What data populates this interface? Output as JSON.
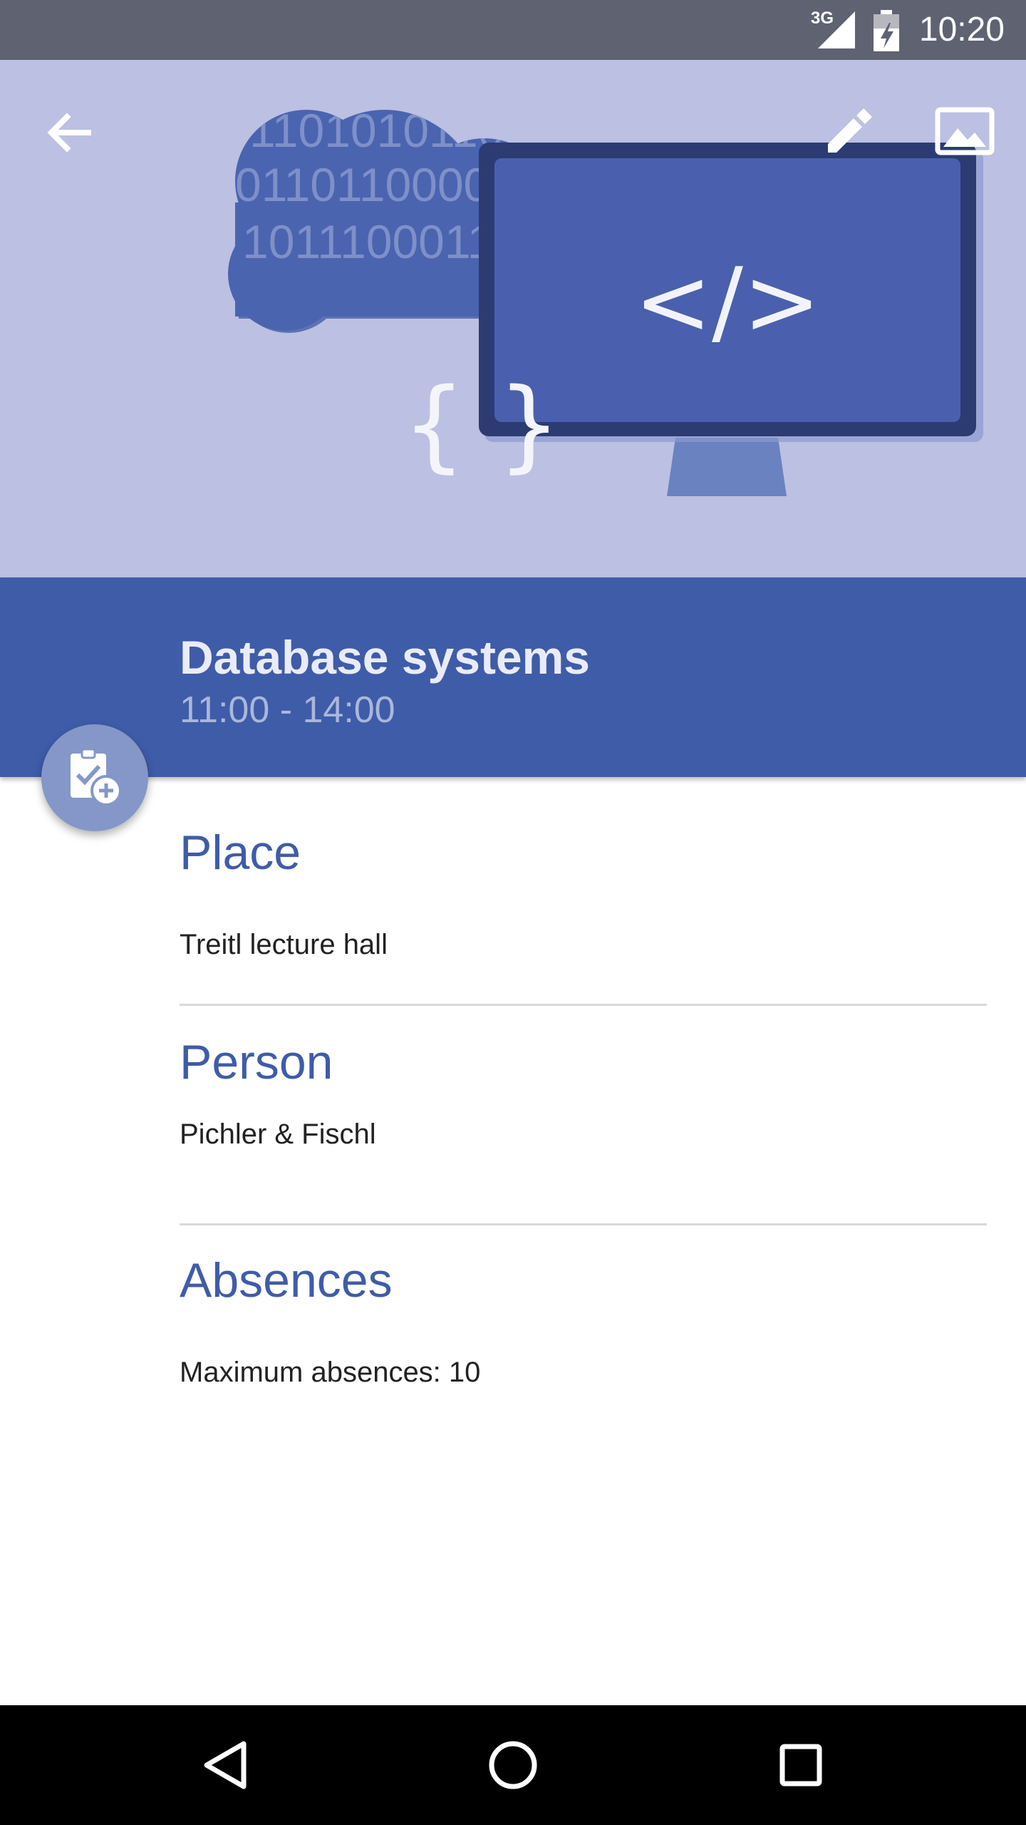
{
  "status_bar": {
    "time": "10:20",
    "network": "3G",
    "icons": [
      "signal-icon",
      "battery-icon"
    ]
  },
  "header": {
    "binary_lines": [
      "011000",
      "1101010110",
      "0110110000",
      "1011100011"
    ],
    "code_glyph": "</>",
    "braces_glyph": "{ }",
    "actions": {
      "back_icon": "arrow-back-icon",
      "edit_icon": "pencil-icon",
      "image_icon": "image-icon"
    }
  },
  "course": {
    "title": "Database systems",
    "time": "11:00 - 14:00"
  },
  "fab": {
    "icon": "clipboard-check-add-icon"
  },
  "sections": {
    "place": {
      "heading": "Place",
      "value": "Treitl lecture hall"
    },
    "person": {
      "heading": "Person",
      "value": "Pichler & Fischl"
    },
    "absences": {
      "heading": "Absences",
      "value": "Maximum absences: 10"
    }
  },
  "nav_bar": {
    "icons": [
      "back-triangle-icon",
      "home-circle-icon",
      "recents-square-icon"
    ]
  },
  "colors": {
    "primary": "#3f5ca9",
    "header_bg": "#bcc0e2",
    "fab": "#8497c8",
    "status_bar": "#5f6271"
  }
}
